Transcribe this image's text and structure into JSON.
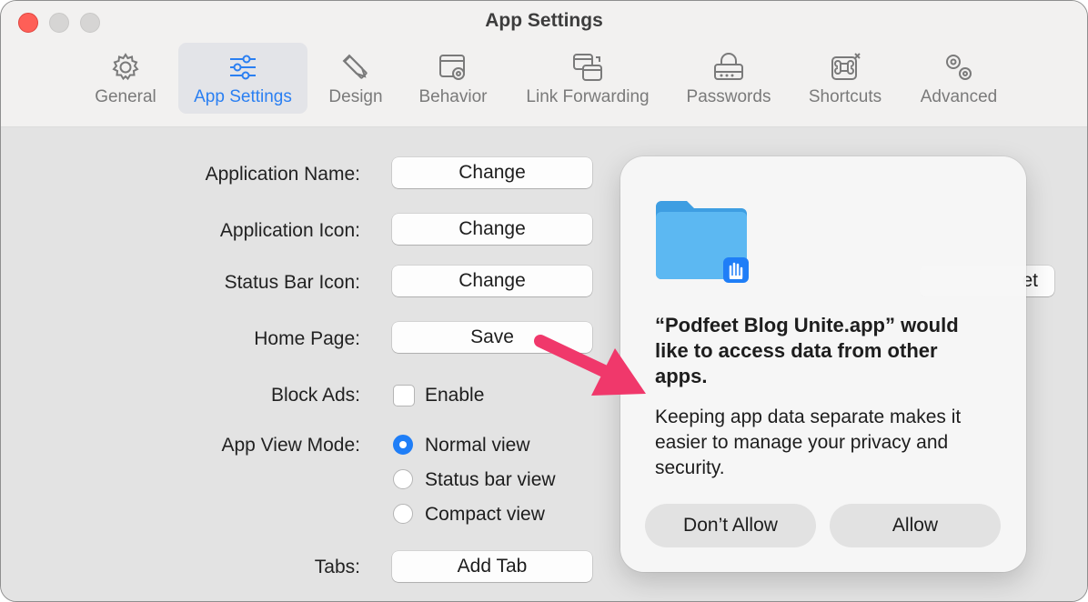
{
  "window": {
    "title": "App Settings"
  },
  "toolbar": {
    "tabs": [
      {
        "label": "General",
        "icon": "gear-icon"
      },
      {
        "label": "App Settings",
        "icon": "sliders-icon",
        "active": true
      },
      {
        "label": "Design",
        "icon": "design-tools-icon"
      },
      {
        "label": "Behavior",
        "icon": "window-gear-icon"
      },
      {
        "label": "Link Forwarding",
        "icon": "link-forwarding-icon"
      },
      {
        "label": "Passwords",
        "icon": "password-lock-icon"
      },
      {
        "label": "Shortcuts",
        "icon": "command-key-icon"
      },
      {
        "label": "Advanced",
        "icon": "gears-icon"
      }
    ]
  },
  "settings": {
    "app_name": {
      "label": "Application Name:",
      "button": "Change"
    },
    "app_icon": {
      "label": "Application Icon:",
      "button": "Change"
    },
    "status_icon": {
      "label": "Status Bar Icon:",
      "button": "Change"
    },
    "home_page": {
      "label": "Home Page:",
      "button": "Save"
    },
    "block_ads": {
      "label": "Block Ads:",
      "option": "Enable",
      "checked": false
    },
    "view_mode": {
      "label": "App View Mode:",
      "options": [
        "Normal view",
        "Status bar view",
        "Compact view"
      ],
      "selected": "Normal view"
    },
    "tabs": {
      "label": "Tabs:",
      "button": "Add Tab"
    }
  },
  "background_partial": {
    "fragment_right": "et"
  },
  "dialog": {
    "title": "“Podfeet Blog Unite.app” would like to access data from other apps.",
    "body": "Keeping app data separate makes it easier to manage your privacy and security.",
    "deny_label": "Don’t Allow",
    "allow_label": "Allow",
    "icon": "folder-icon",
    "badge_icon": "hand-icon"
  },
  "colors": {
    "accent": "#1f7ef7",
    "close": "#fe5f57",
    "arrow": "#f0386b",
    "folder": "#4eb0ee"
  }
}
